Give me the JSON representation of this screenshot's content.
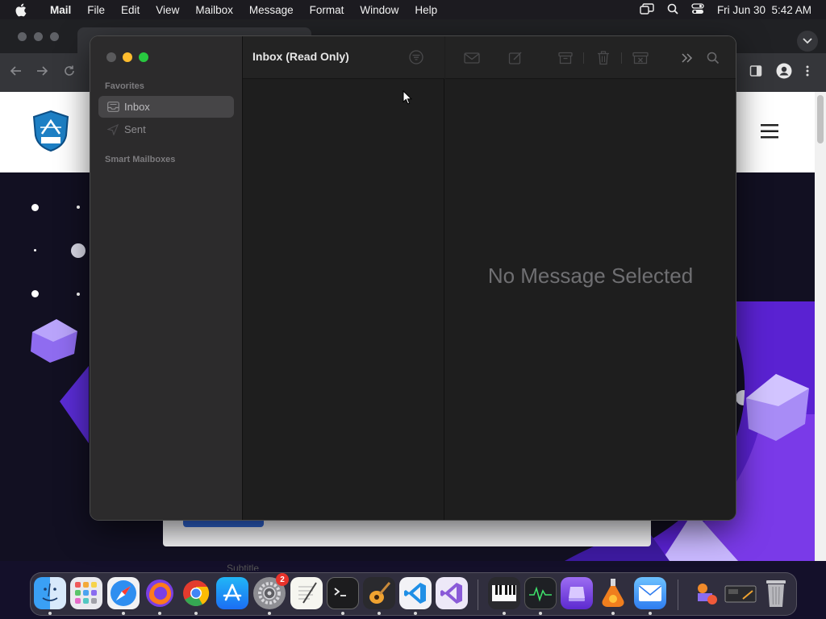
{
  "menubar": {
    "app_name": "Mail",
    "items": [
      "File",
      "Edit",
      "View",
      "Mailbox",
      "Message",
      "Format",
      "Window",
      "Help"
    ],
    "clock": "Fri Jun 30  5:42 AM"
  },
  "mail": {
    "sidebar": {
      "favorites_heading": "Favorites",
      "inbox_label": "Inbox",
      "sent_label": "Sent",
      "smart_mailboxes_heading": "Smart Mailboxes"
    },
    "list_title": "Inbox (Read Only)",
    "empty_state": "No Message Selected"
  },
  "browser": {
    "bottom_text": "Subtitle"
  },
  "dock": {
    "settings_badge": "2"
  },
  "colors": {
    "traffic_close": "#5a5a5c",
    "traffic_minimize": "#febc2e",
    "traffic_zoom": "#28c840",
    "hero_purple": "#6a2fe0"
  }
}
